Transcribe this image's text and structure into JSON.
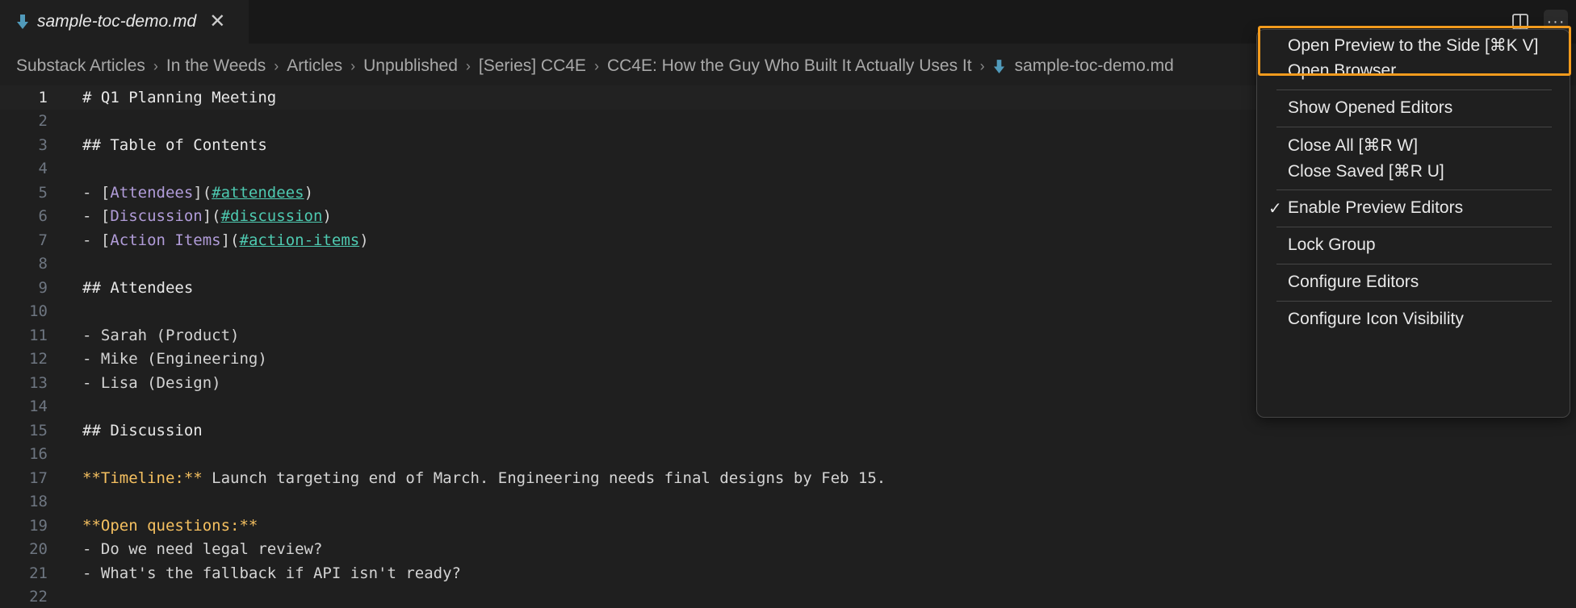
{
  "tab": {
    "label": "sample-toc-demo.md",
    "close": "✕"
  },
  "tab_actions": {
    "split_icon": "split-editor-icon",
    "more_icon": "···"
  },
  "breadcrumb": [
    "Substack Articles",
    "In the Weeds",
    "Articles",
    "Unpublished",
    "[Series] CC4E",
    "CC4E: How the Guy Who Built It Actually Uses It",
    "sample-toc-demo.md"
  ],
  "breadcrumb_separator": "›",
  "editor": {
    "current_line": 1,
    "lines": [
      {
        "n": "1",
        "segments": [
          {
            "t": "# Q1 Planning Meeting",
            "c": "c-heading"
          }
        ]
      },
      {
        "n": "2",
        "segments": []
      },
      {
        "n": "3",
        "segments": [
          {
            "t": "## Table of Contents",
            "c": "c-heading"
          }
        ]
      },
      {
        "n": "4",
        "segments": []
      },
      {
        "n": "5",
        "segments": [
          {
            "t": "- [",
            "c": ""
          },
          {
            "t": "Attendees",
            "c": "c-link-text"
          },
          {
            "t": "](",
            "c": ""
          },
          {
            "t": "#attendees",
            "c": "c-link-url"
          },
          {
            "t": ")",
            "c": ""
          }
        ]
      },
      {
        "n": "6",
        "segments": [
          {
            "t": "- [",
            "c": ""
          },
          {
            "t": "Discussion",
            "c": "c-link-text"
          },
          {
            "t": "](",
            "c": ""
          },
          {
            "t": "#discussion",
            "c": "c-link-url"
          },
          {
            "t": ")",
            "c": ""
          }
        ]
      },
      {
        "n": "7",
        "segments": [
          {
            "t": "- [",
            "c": ""
          },
          {
            "t": "Action Items",
            "c": "c-link-text"
          },
          {
            "t": "](",
            "c": ""
          },
          {
            "t": "#action-items",
            "c": "c-link-url"
          },
          {
            "t": ")",
            "c": ""
          }
        ]
      },
      {
        "n": "8",
        "segments": []
      },
      {
        "n": "9",
        "segments": [
          {
            "t": "## Attendees",
            "c": "c-heading"
          }
        ]
      },
      {
        "n": "10",
        "segments": []
      },
      {
        "n": "11",
        "segments": [
          {
            "t": "- Sarah (Product)",
            "c": ""
          }
        ]
      },
      {
        "n": "12",
        "segments": [
          {
            "t": "- Mike (Engineering)",
            "c": ""
          }
        ]
      },
      {
        "n": "13",
        "segments": [
          {
            "t": "- Lisa (Design)",
            "c": ""
          }
        ]
      },
      {
        "n": "14",
        "segments": []
      },
      {
        "n": "15",
        "segments": [
          {
            "t": "## Discussion",
            "c": "c-heading"
          }
        ]
      },
      {
        "n": "16",
        "segments": []
      },
      {
        "n": "17",
        "segments": [
          {
            "t": "**Timeline:**",
            "c": "c-bold"
          },
          {
            "t": " Launch targeting end of March. Engineering needs final designs by Feb 15.",
            "c": ""
          }
        ]
      },
      {
        "n": "18",
        "segments": []
      },
      {
        "n": "19",
        "segments": [
          {
            "t": "**Open questions:**",
            "c": "c-bold"
          }
        ]
      },
      {
        "n": "20",
        "segments": [
          {
            "t": "- Do we need legal review?",
            "c": ""
          }
        ]
      },
      {
        "n": "21",
        "segments": [
          {
            "t": "- What's the fallback if API isn't ready?",
            "c": ""
          }
        ]
      },
      {
        "n": "22",
        "segments": []
      }
    ]
  },
  "menu": {
    "items": [
      {
        "label": "Open Preview to the Side [⌘K V]",
        "checked": false
      },
      {
        "label": "Open Browser",
        "checked": false
      },
      {
        "label": "Show Opened Editors",
        "checked": false
      },
      {
        "label": "Close All [⌘R W]",
        "checked": false
      },
      {
        "label": "Close Saved [⌘R U]",
        "checked": false
      },
      {
        "label": "Enable Preview Editors",
        "checked": true
      },
      {
        "label": "Lock Group",
        "checked": false
      },
      {
        "label": "Configure Editors",
        "checked": false
      },
      {
        "label": "Configure Icon Visibility",
        "checked": false
      }
    ],
    "check_glyph": "✓"
  },
  "colors": {
    "highlight": "#f29b1d",
    "markdown_icon": "#519aba"
  }
}
